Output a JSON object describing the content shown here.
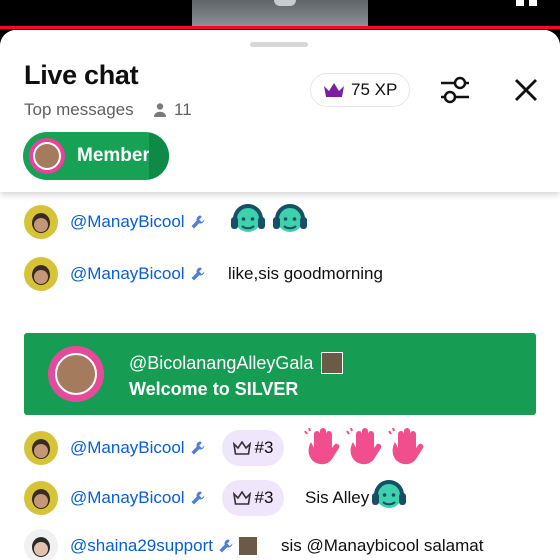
{
  "header": {
    "title": "Live chat",
    "mode_label": "Top messages",
    "viewer_count": "11",
    "xp_label": "75 XP",
    "member_chip_label": "Member"
  },
  "icons": {
    "crown_color": "#7b1fa2",
    "member_green": "#16a154"
  },
  "messages": [
    {
      "author": "@ManayBicool",
      "text": "",
      "emoji": [
        "person-with-headphones-emoji",
        "person-with-headphones-emoji"
      ]
    },
    {
      "author": "@ManayBicool",
      "text": "like,sis goodmorning"
    },
    {
      "author": "@ManayBicool",
      "rank": "#3",
      "text": "",
      "emoji": [
        "waving-hand-emoji",
        "waving-hand-emoji",
        "waving-hand-emoji"
      ]
    },
    {
      "author": "@ManayBicool",
      "rank": "#3",
      "text": "Sis Alley",
      "emoji": [
        "person-with-headphones-emoji"
      ]
    },
    {
      "author": "@shaina29support",
      "text": "sis @Manaybicool salamat"
    }
  ],
  "welcome": {
    "author": "@BicolanangAlleyGala",
    "text": "Welcome to SILVER"
  }
}
